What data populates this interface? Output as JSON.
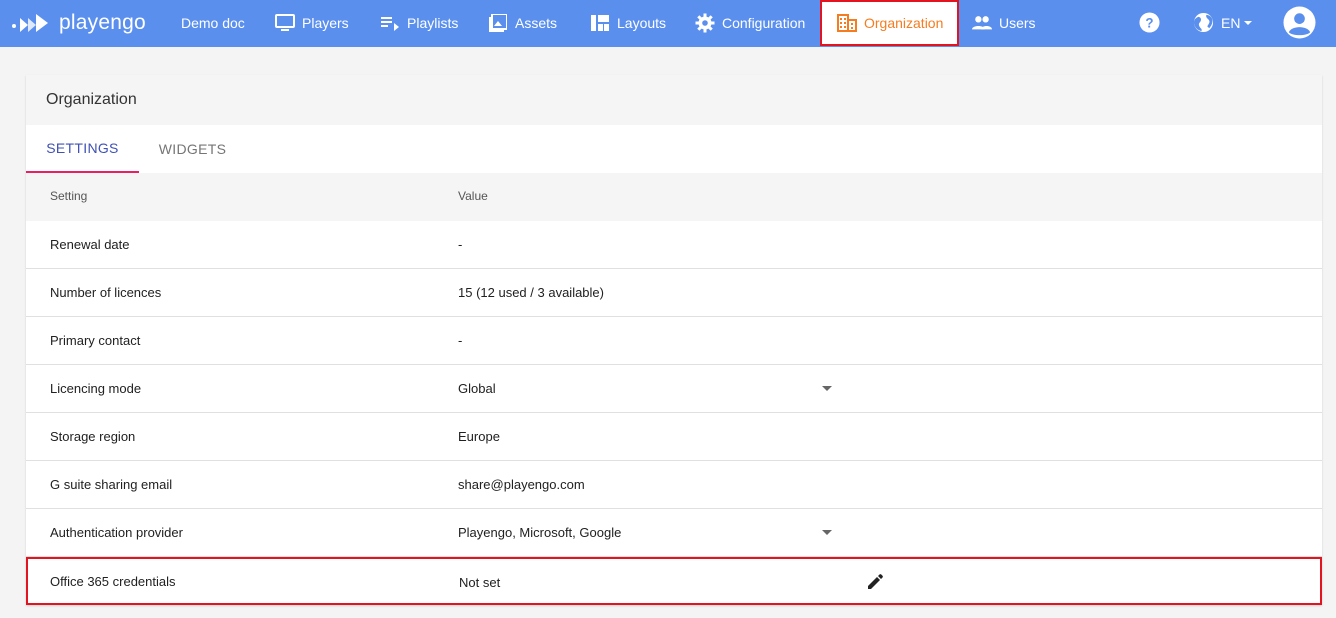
{
  "app": {
    "brand": "playengo"
  },
  "nav": {
    "items": [
      {
        "label": "Demo doc",
        "icon": "none"
      },
      {
        "label": "Players",
        "icon": "monitor-icon"
      },
      {
        "label": "Playlists",
        "icon": "playlist-icon"
      },
      {
        "label": "Assets",
        "icon": "image-icon"
      },
      {
        "label": "Layouts",
        "icon": "layout-icon"
      },
      {
        "label": "Configuration",
        "icon": "gear-icon"
      },
      {
        "label": "Organization",
        "icon": "building-icon"
      },
      {
        "label": "Users",
        "icon": "users-icon"
      }
    ],
    "language": "EN"
  },
  "card": {
    "title": "Organization",
    "tabs": [
      "SETTINGS",
      "WIDGETS"
    ],
    "columns": {
      "setting": "Setting",
      "value": "Value"
    },
    "rows": [
      {
        "setting": "Renewal date",
        "value": "-"
      },
      {
        "setting": "Number of licences",
        "value": "15 (12 used / 3 available)"
      },
      {
        "setting": "Primary contact",
        "value": "-"
      },
      {
        "setting": "Licencing mode",
        "value": "Global"
      },
      {
        "setting": "Storage region",
        "value": "Europe"
      },
      {
        "setting": "G suite sharing email",
        "value": "share@playengo.com"
      },
      {
        "setting": "Authentication provider",
        "value": "Playengo, Microsoft, Google"
      },
      {
        "setting": "Office 365 credentials",
        "value": "Not set"
      }
    ]
  },
  "colors": {
    "topbar": "#5a8fee",
    "active_nav_text": "#f57c1f",
    "highlight_border": "#e3131f",
    "tab_active": "#3f51b5",
    "tab_indicator": "#e91e63"
  }
}
